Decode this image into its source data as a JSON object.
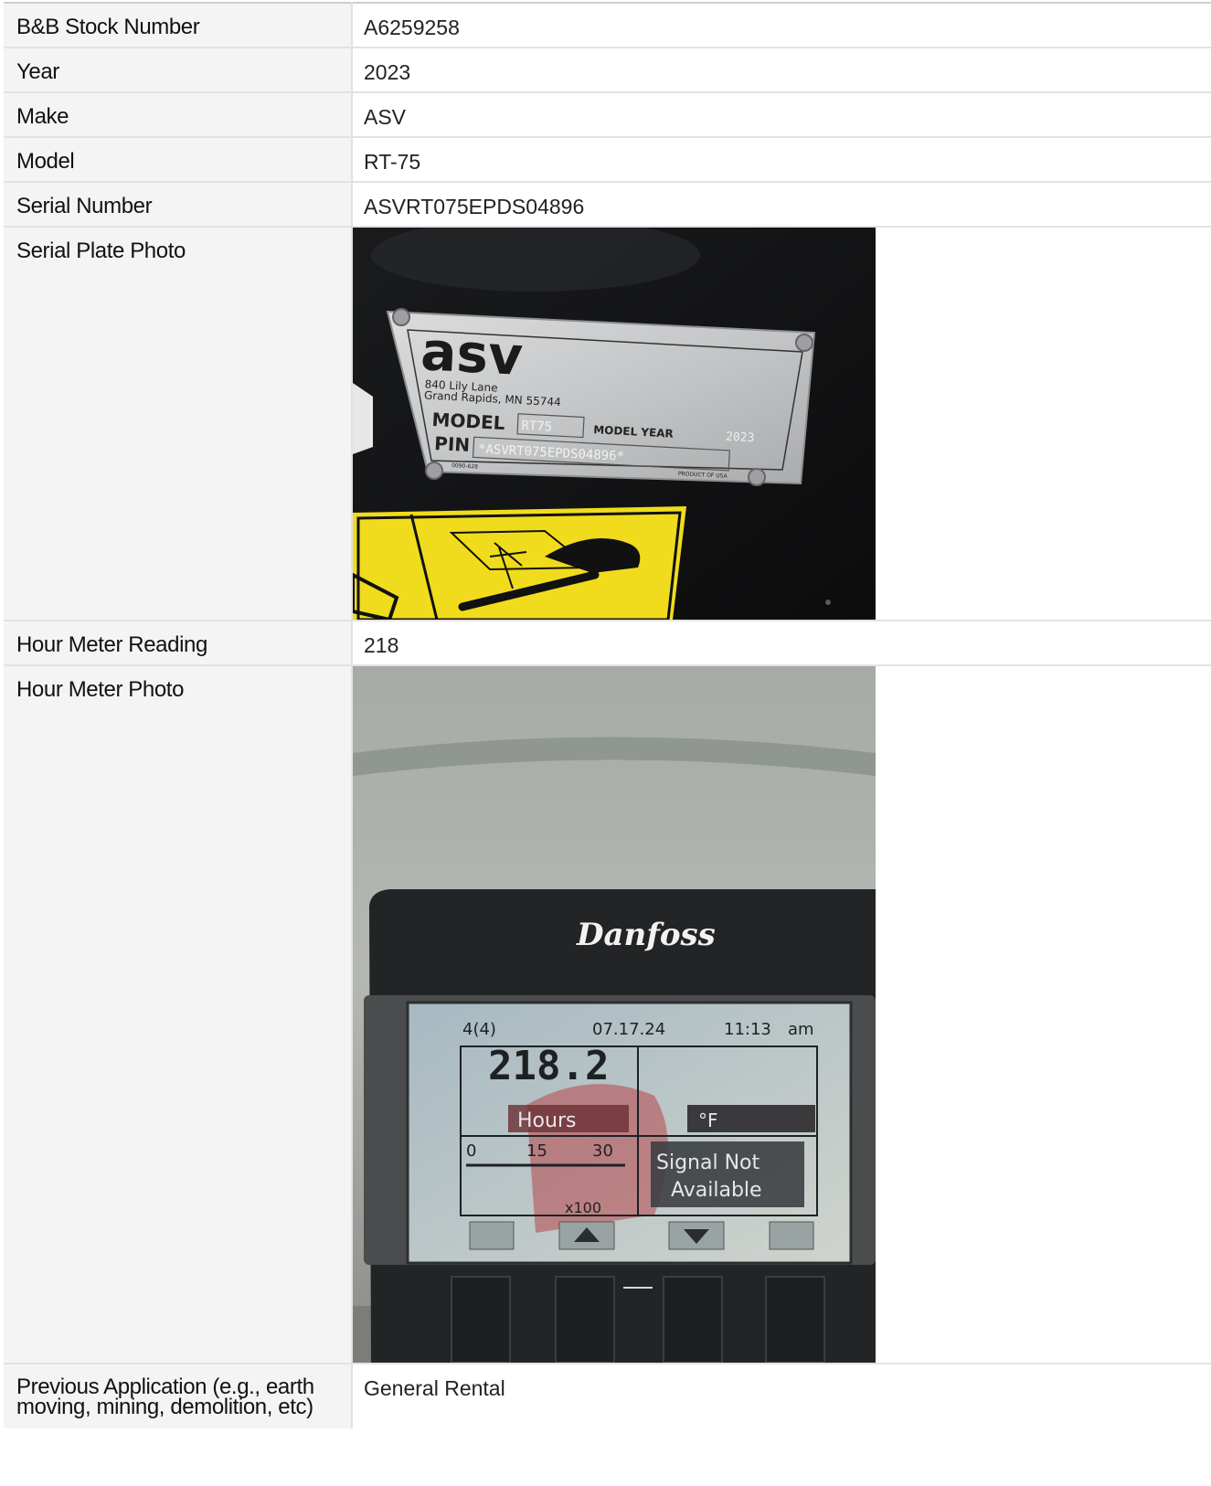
{
  "rows": [
    {
      "label": "B&B Stock Number",
      "value": "A6259258"
    },
    {
      "label": "Year",
      "value": "2023"
    },
    {
      "label": "Make",
      "value": "ASV"
    },
    {
      "label": "Model",
      "value": "RT-75"
    },
    {
      "label": "Serial Number",
      "value": "ASVRT075EPDS04896"
    },
    {
      "label": "Serial Plate Photo",
      "value": ""
    },
    {
      "label": "Hour Meter Reading",
      "value": "218"
    },
    {
      "label": "Hour Meter Photo",
      "value": ""
    },
    {
      "label": "Previous Application (e.g., earth moving, mining, demolition, etc)",
      "value": "General Rental"
    }
  ],
  "serial_plate": {
    "logo": "asv",
    "address_line1": "840 Lily Lane",
    "address_line2": "Grand Rapids, MN 55744",
    "model_label": "MODEL",
    "model_value": "RT75",
    "model_year_label": "MODEL YEAR",
    "model_year_value": "2023",
    "pin_label": "PIN",
    "pin_value": "*ASVRT075EPDS04896*",
    "part_no": "0090-628",
    "origin": "PRODUCT OF USA"
  },
  "hour_meter": {
    "brand": "Danfoss",
    "page": "4(4)",
    "date": "07.17.24",
    "time": "11:13",
    "ampm": "am",
    "hours": "218.2",
    "hours_label": "Hours",
    "temp_unit": "°F",
    "scale_0": "0",
    "scale_15": "15",
    "scale_30": "30",
    "scale_mult": "x100",
    "signal_line1": "Signal Not",
    "signal_line2": "Available"
  }
}
